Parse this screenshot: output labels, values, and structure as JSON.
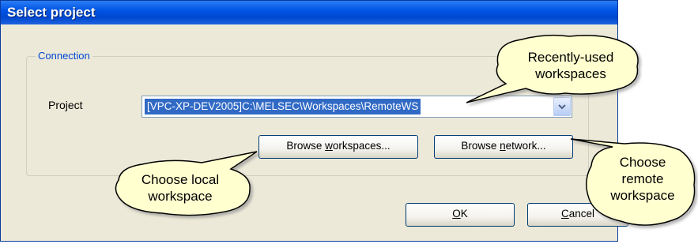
{
  "window": {
    "title": "Select project"
  },
  "connection": {
    "group_label": "Connection",
    "project_label": "Project",
    "project_value": "[VPC-XP-DEV2005]C:\\MELSEC\\Workspaces\\RemoteWS"
  },
  "buttons": {
    "browse_workspaces": {
      "pre": "Browse ",
      "mnemonic": "w",
      "post": "orkspaces..."
    },
    "browse_network": {
      "pre": "Browse ",
      "mnemonic": "n",
      "post": "etwork..."
    },
    "ok": {
      "pre": "",
      "mnemonic": "O",
      "post": "K"
    },
    "cancel": {
      "pre": "",
      "mnemonic": "C",
      "post": "ancel"
    }
  },
  "callouts": {
    "recent": {
      "line1": "Recently-used",
      "line2": "workspaces"
    },
    "local": {
      "line1": "Choose local",
      "line2": "workspace"
    },
    "remote": {
      "line1": "Choose",
      "line2": "remote",
      "line3": "workspace"
    }
  },
  "colors": {
    "title_bar": "#0055e5",
    "selection": "#316ac5",
    "callout_fill": "#ffffd0",
    "group_label": "#0046d5"
  },
  "icons": {
    "combo_dropdown": "chevron-down-icon"
  }
}
